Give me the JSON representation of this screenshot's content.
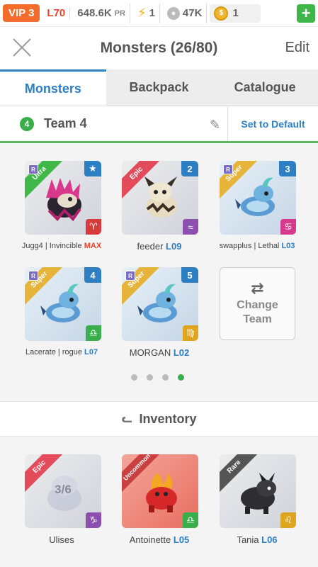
{
  "statusbar": {
    "vip": "VIP 3",
    "level": "L70",
    "power": "648.6K",
    "power_unit": "PR",
    "energy": "1",
    "food": "47K",
    "coins": "1",
    "add": "+"
  },
  "header": {
    "title": "Monsters (26/80)",
    "edit": "Edit"
  },
  "tabs": [
    {
      "label": "Monsters",
      "active": true
    },
    {
      "label": "Backpack",
      "active": false
    },
    {
      "label": "Catalogue",
      "active": false
    }
  ],
  "team": {
    "number": "4",
    "name": "Team 4",
    "set_default": "Set to Default"
  },
  "team_monsters": [
    {
      "rarity": "Ultra",
      "badge": "★",
      "zodiac": "♈",
      "name": "Jugg4",
      "sep": " | ",
      "extra": "Invincible",
      "level": "MAX"
    },
    {
      "rarity": "Epic",
      "badge": "2",
      "zodiac": "≈",
      "name": "feeder",
      "level": "L09"
    },
    {
      "rarity": "Super",
      "badge": "3",
      "zodiac": "♋",
      "name": "swapplus",
      "sep": " | ",
      "extra": "Lethal",
      "level": "L03"
    },
    {
      "rarity": "Super",
      "badge": "4",
      "zodiac": "♎",
      "name": "Lacerate",
      "sep": " | ",
      "extra": "rogue",
      "level": "L07"
    },
    {
      "rarity": "Super",
      "badge": "5",
      "zodiac": "♍",
      "name": "MORGAN",
      "level": "L02"
    }
  ],
  "change_team": {
    "label_1": "Change",
    "label_2": "Team",
    "icon": "⇄"
  },
  "pager": {
    "pages": 4,
    "current": 4
  },
  "inventory": {
    "title": "Inventory",
    "items": [
      {
        "rarity": "Epic",
        "progress": "3/6",
        "zodiac": "♑",
        "name": "Ulises",
        "level": ""
      },
      {
        "rarity": "Uncommon",
        "zodiac": "♎",
        "name": "Antoinette",
        "level": "L05"
      },
      {
        "rarity": "Rare",
        "zodiac": "♌",
        "name": "Tania",
        "level": "L06"
      }
    ]
  },
  "colors": {
    "accent": "#2d7fc4",
    "green": "#3aae4a",
    "orange": "#f26c2b"
  }
}
